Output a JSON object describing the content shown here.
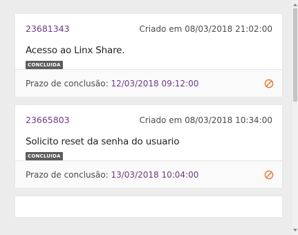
{
  "tickets": [
    {
      "id": "23681343",
      "created": "Criado em 08/03/2018 21:02:00",
      "title": "Acesso ao Linx Share.",
      "status": "CONCLUIDA",
      "deadline_label": "Prazo de conclusão:",
      "deadline_value": "12/03/2018 09:12:00"
    },
    {
      "id": "23665803",
      "created": "Criado em 08/03/2018 10:34:00",
      "title": "Solicito reset da senha do usuario",
      "status": "CONCLUIDA",
      "deadline_label": "Prazo de conclusão:",
      "deadline_value": "13/03/2018 10:04:00"
    }
  ],
  "colors": {
    "accent": "#6b3a86",
    "badge_bg": "#5c5c5c",
    "overdue_icon": "#f07a3a"
  },
  "icons": {
    "overdue": "prohibited-icon"
  }
}
